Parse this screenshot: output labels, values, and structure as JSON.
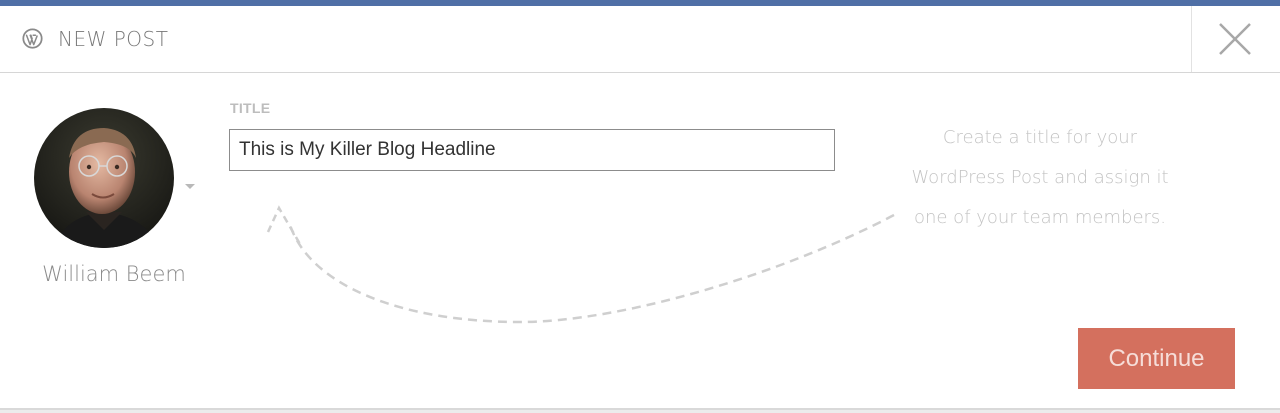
{
  "header": {
    "title": "NEW POST",
    "icon": "wordpress-icon",
    "close_icon": "close-icon"
  },
  "author": {
    "name": "William Beem",
    "avatar": "author-avatar",
    "dropdown_icon": "caret-down-icon"
  },
  "form": {
    "title_label": "TITLE",
    "title_value": "This is My Killer Blog Headline"
  },
  "hint": {
    "lines": [
      "Create a title for your",
      "WordPress Post and assign it",
      "one of your team members."
    ]
  },
  "actions": {
    "continue_label": "Continue"
  },
  "colors": {
    "accent_bar": "#4f6fa6",
    "continue_button": "#d4705e",
    "hint_text": "#c3c3c3"
  }
}
